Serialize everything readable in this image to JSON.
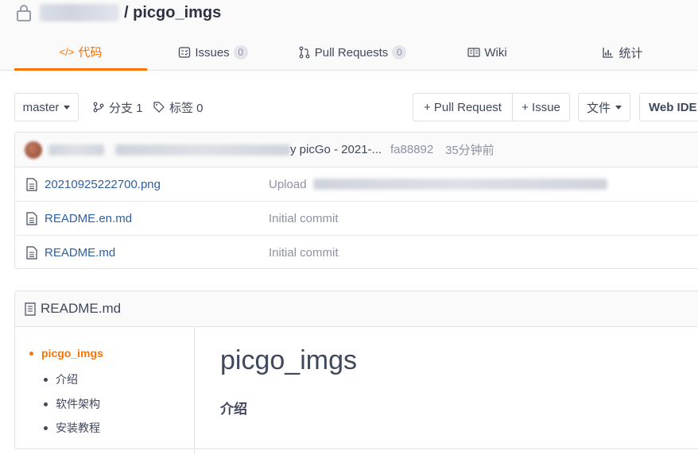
{
  "header": {
    "repo_name": "/ picgo_imgs"
  },
  "tabs": [
    {
      "label": "代码",
      "glyph": "</>"
    },
    {
      "label": "Issues",
      "count": "0"
    },
    {
      "label": "Pull Requests",
      "count": "0"
    },
    {
      "label": "Wiki"
    },
    {
      "label": "统计"
    }
  ],
  "toolbar": {
    "branch": "master",
    "branches_label": "分支 1",
    "tags_label": "标签 0",
    "pull_request_label": "+ Pull Request",
    "issue_label": "+ Issue",
    "file_label": "文件",
    "webide_label": "Web IDE"
  },
  "latest_commit": {
    "message_tail": "y picGo - 2021-...",
    "hash": "fa88892",
    "time": "35分钟前"
  },
  "files": [
    {
      "name": "20210925222700.png",
      "message": "Upload"
    },
    {
      "name": "README.en.md",
      "message": "Initial commit"
    },
    {
      "name": "README.md",
      "message": "Initial commit"
    }
  ],
  "readme": {
    "filename": "README.md",
    "toc": [
      {
        "label": "picgo_imgs",
        "level": 1
      },
      {
        "label": "介绍",
        "level": 2
      },
      {
        "label": "软件架构",
        "level": 2
      },
      {
        "label": "安装教程",
        "level": 2
      }
    ],
    "h1": "picgo_imgs",
    "h2": "介绍"
  },
  "colors": {
    "accent": "#fe7300",
    "link": "#2f5fa0",
    "muted": "#8c92a4"
  }
}
